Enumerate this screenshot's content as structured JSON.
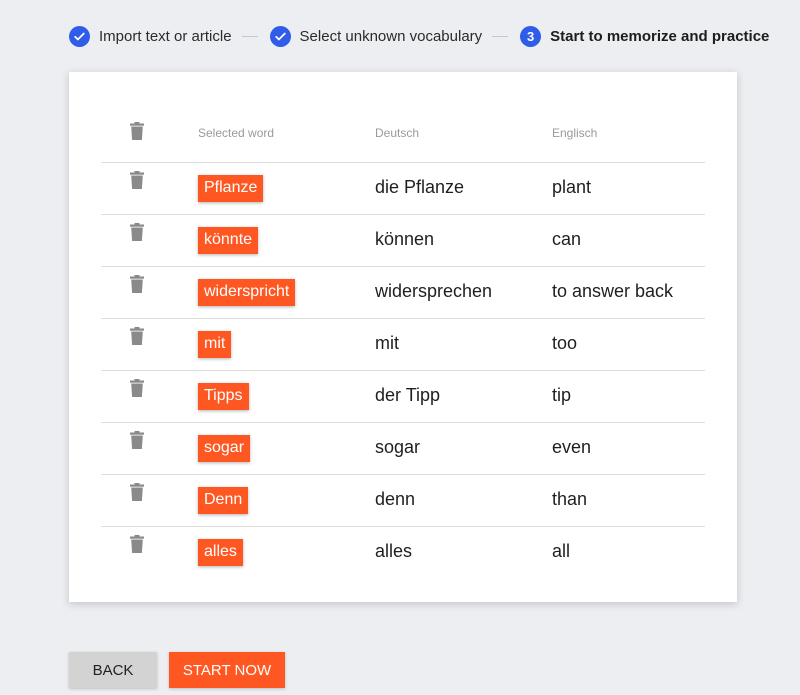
{
  "stepper": {
    "steps": [
      {
        "label": "Import text or article",
        "icon": "check-icon",
        "status": "done"
      },
      {
        "label": "Select unknown vocabulary",
        "icon": "check-icon",
        "status": "done"
      },
      {
        "label": "Start to memorize and practice",
        "number": "3",
        "status": "active"
      }
    ]
  },
  "table": {
    "headers": {
      "word": "Selected word",
      "de": "Deutsch",
      "en": "Englisch"
    },
    "rows": [
      {
        "word": "Pflanze",
        "de": "die Pflanze",
        "en": "plant"
      },
      {
        "word": "könnte",
        "de": "können",
        "en": "can"
      },
      {
        "word": "widerspricht",
        "de": "widersprechen",
        "en": "to answer back"
      },
      {
        "word": "mit",
        "de": "mit",
        "en": "too"
      },
      {
        "word": "Tipps",
        "de": "der Tipp",
        "en": "tip"
      },
      {
        "word": "sogar",
        "de": "sogar",
        "en": "even"
      },
      {
        "word": "Denn",
        "de": "denn",
        "en": "than"
      },
      {
        "word": "alles",
        "de": "alles",
        "en": "all"
      }
    ]
  },
  "buttons": {
    "back": "BACK",
    "start": "START NOW"
  },
  "colors": {
    "accent": "#ff5722",
    "step": "#2f5ce8",
    "trash": "#8a8a8a"
  }
}
